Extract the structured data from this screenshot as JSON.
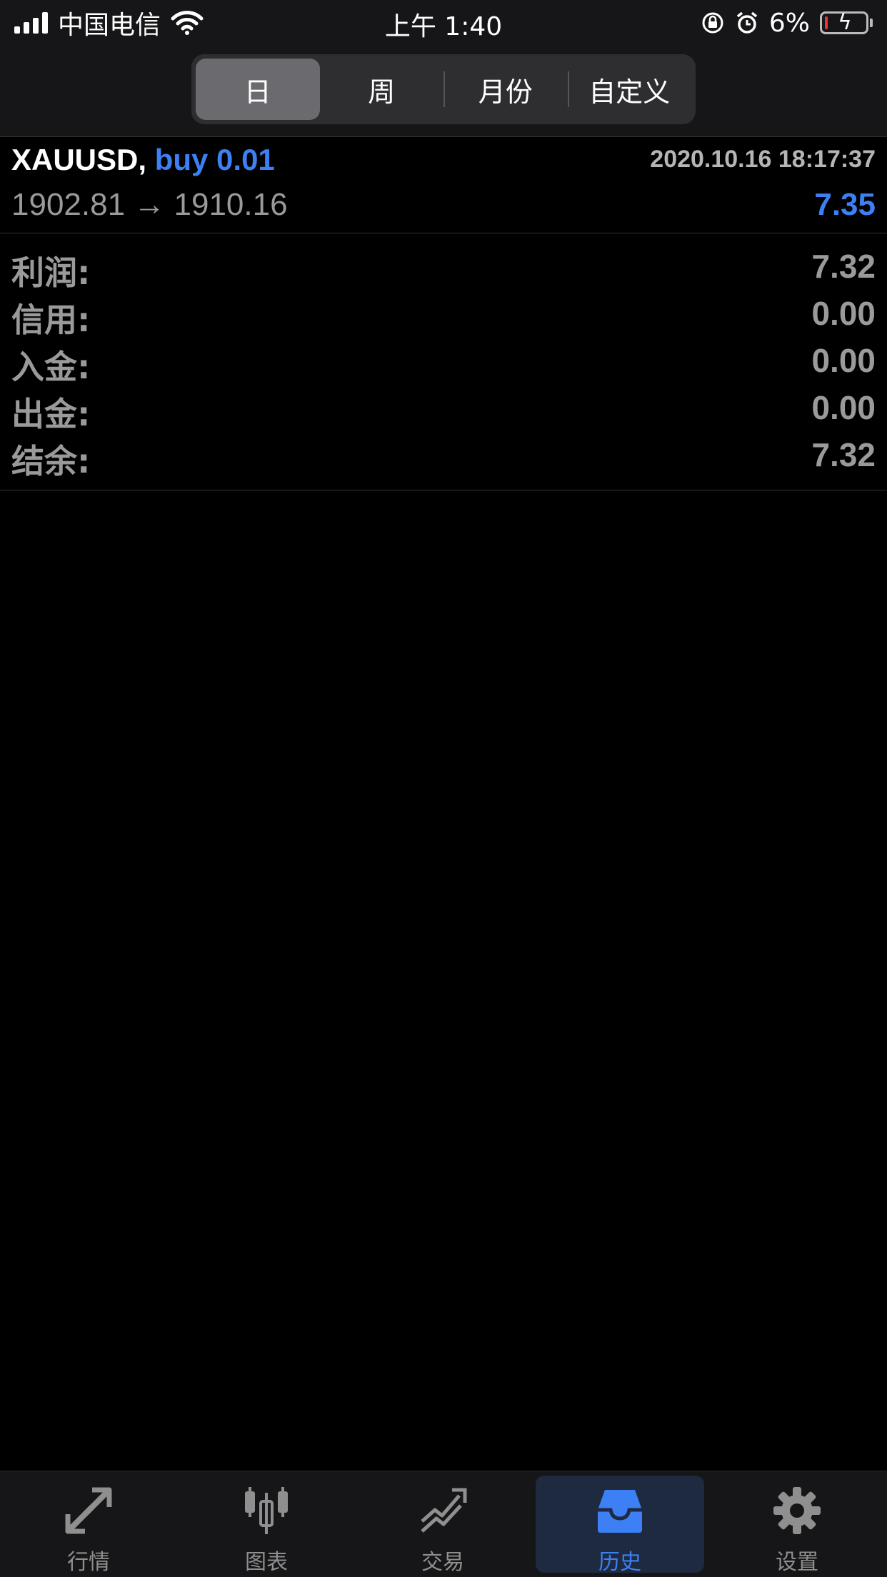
{
  "status_bar": {
    "carrier": "中国电信",
    "time": "上午 1:40",
    "battery": "6%"
  },
  "segments": [
    {
      "label": "日",
      "active": true
    },
    {
      "label": "周",
      "active": false
    },
    {
      "label": "月份",
      "active": false
    },
    {
      "label": "自定义",
      "active": false
    }
  ],
  "trade": {
    "symbol": "XAUUSD,",
    "side": "buy 0.01",
    "datetime": "2020.10.16 18:17:37",
    "prices": "1902.81 → 1910.16",
    "profit": "7.35"
  },
  "summary": [
    {
      "label": "利润:",
      "value": "7.32"
    },
    {
      "label": "信用:",
      "value": "0.00"
    },
    {
      "label": "入金:",
      "value": "0.00"
    },
    {
      "label": "出金:",
      "value": "0.00"
    },
    {
      "label": "结余:",
      "value": "7.32"
    }
  ],
  "nav": [
    {
      "label": "行情",
      "icon": "quotes-icon"
    },
    {
      "label": "图表",
      "icon": "chart-icon"
    },
    {
      "label": "交易",
      "icon": "trade-icon"
    },
    {
      "label": "历史",
      "icon": "history-icon",
      "active": true
    },
    {
      "label": "设置",
      "icon": "settings-icon"
    }
  ],
  "colors": {
    "accent": "#3d7ff5",
    "background": "#000000",
    "bar": "#161618"
  }
}
